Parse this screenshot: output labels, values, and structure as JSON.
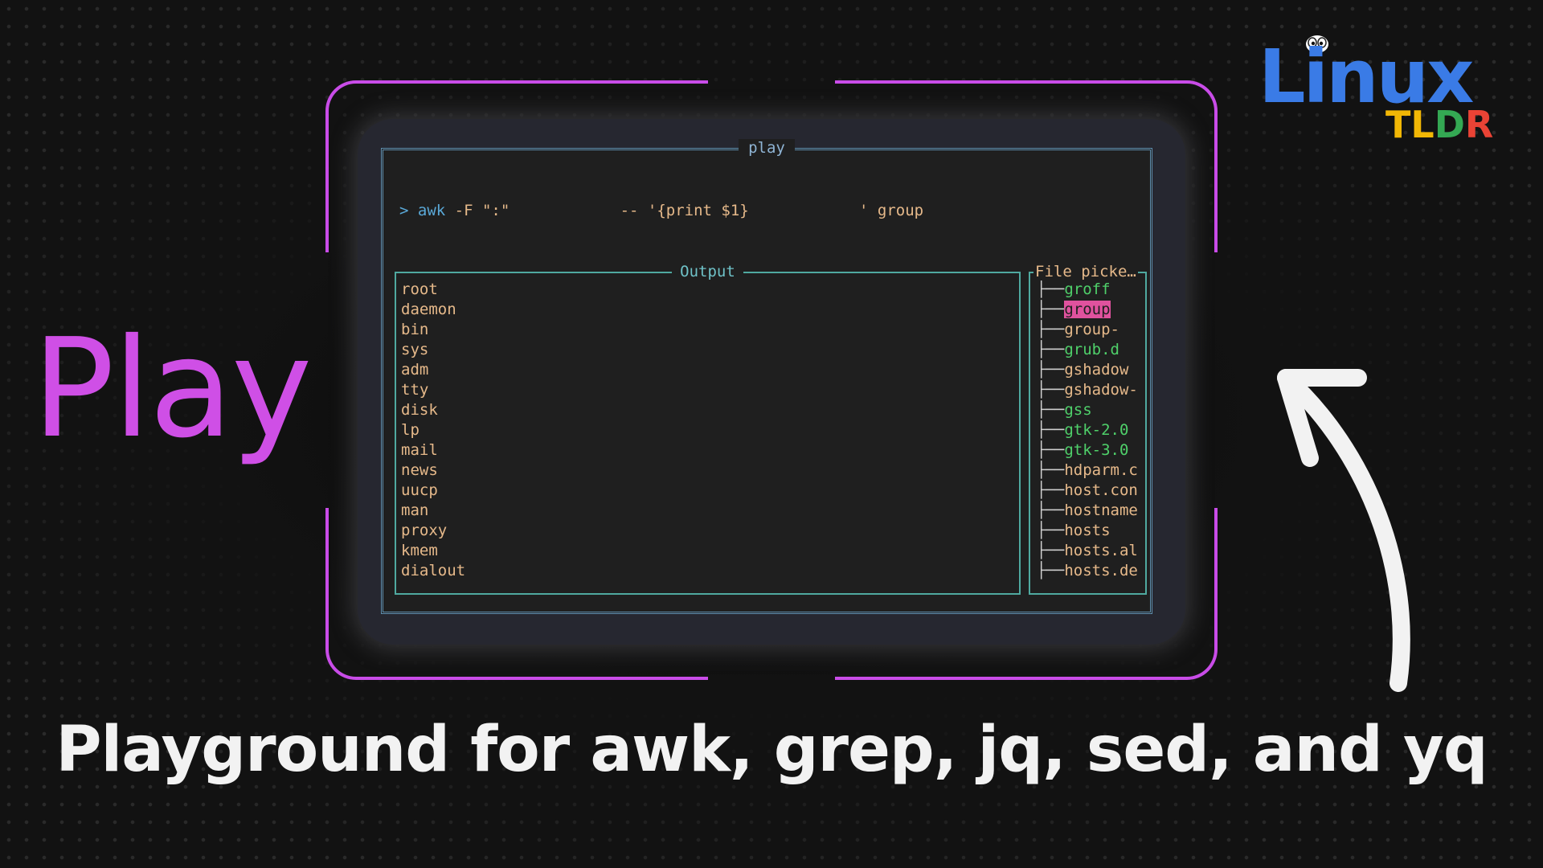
{
  "logo": {
    "brand": "Linux",
    "sub_letters": [
      {
        "char": "T",
        "color": "#f2b705"
      },
      {
        "char": "L",
        "color": "#f2b705"
      },
      {
        "char": "D",
        "color": "#34a853"
      },
      {
        "char": "R",
        "color": "#ea4335"
      }
    ]
  },
  "headline": "Play",
  "tagline": "Playground for awk, grep, jq, sed, and yq",
  "terminal": {
    "title": "play",
    "command": {
      "prompt": ">",
      "program": "awk",
      "flag": " -F \":\"",
      "spacer1": "            ",
      "expression": "-- '{print $1}",
      "spacer2": "            ",
      "target": "' group"
    },
    "output": {
      "title": "Output",
      "lines": [
        "root",
        "daemon",
        "bin",
        "sys",
        "adm",
        "tty",
        "disk",
        "lp",
        "mail",
        "news",
        "uucp",
        "man",
        "proxy",
        "kmem",
        "dialout"
      ]
    },
    "file_picker": {
      "title": "File picke…",
      "items": [
        {
          "name": "groff",
          "type": "dir"
        },
        {
          "name": "group",
          "type": "file",
          "selected": true
        },
        {
          "name": "group-",
          "type": "file"
        },
        {
          "name": "grub.d",
          "type": "dir"
        },
        {
          "name": "gshadow",
          "type": "file"
        },
        {
          "name": "gshadow-",
          "type": "file"
        },
        {
          "name": "gss",
          "type": "dir"
        },
        {
          "name": "gtk-2.0",
          "type": "dir"
        },
        {
          "name": "gtk-3.0",
          "type": "dir"
        },
        {
          "name": "hdparm.c",
          "type": "file"
        },
        {
          "name": "host.con",
          "type": "file"
        },
        {
          "name": "hostname",
          "type": "file"
        },
        {
          "name": "hosts",
          "type": "file"
        },
        {
          "name": "hosts.al",
          "type": "file"
        },
        {
          "name": "hosts.de",
          "type": "file"
        }
      ]
    }
  },
  "colors": {
    "accent": "#cf4fe6",
    "frame": "#c94ce8",
    "brand_blue": "#3a7be6",
    "selected_bg": "#e0529e",
    "dir": "#4fd06a",
    "file": "#e6b98a"
  },
  "icons": [
    "tux-icon",
    "curved-arrow-icon"
  ]
}
